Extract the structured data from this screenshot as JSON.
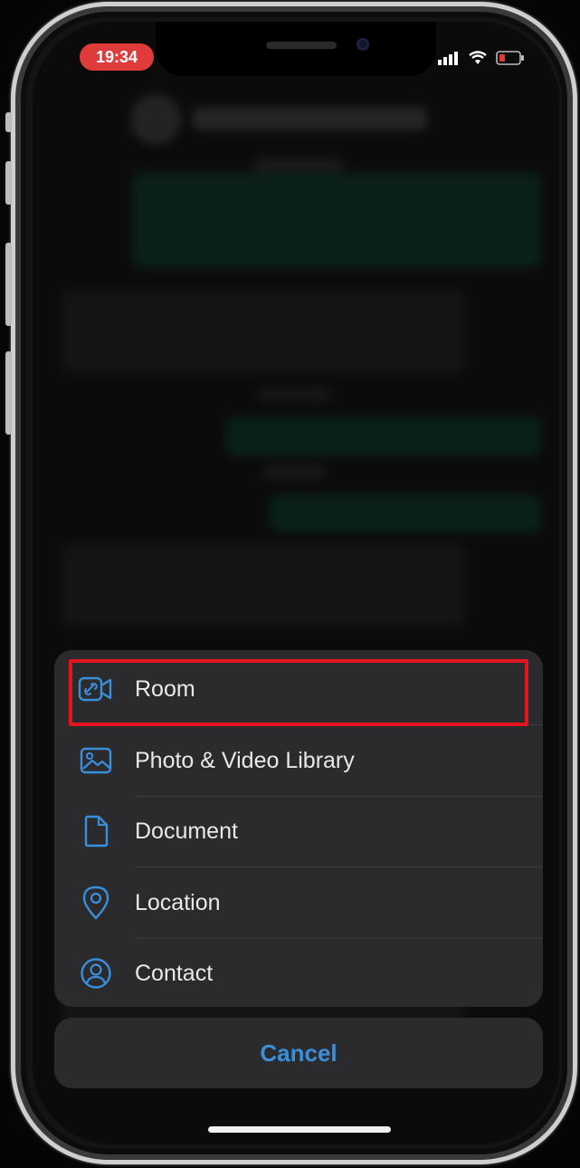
{
  "status_bar": {
    "time": "19:34"
  },
  "action_sheet": {
    "items": [
      {
        "label": "Room",
        "icon": "video-room-icon"
      },
      {
        "label": "Photo & Video Library",
        "icon": "photo-icon"
      },
      {
        "label": "Document",
        "icon": "document-icon"
      },
      {
        "label": "Location",
        "icon": "location-pin-icon"
      },
      {
        "label": "Contact",
        "icon": "contact-icon"
      }
    ],
    "cancel_label": "Cancel"
  },
  "colors": {
    "accent": "#3a8fdc",
    "highlight": "#e2141e",
    "time_pill": "#e03b3b",
    "sheet_bg": "#2b2b2d"
  }
}
